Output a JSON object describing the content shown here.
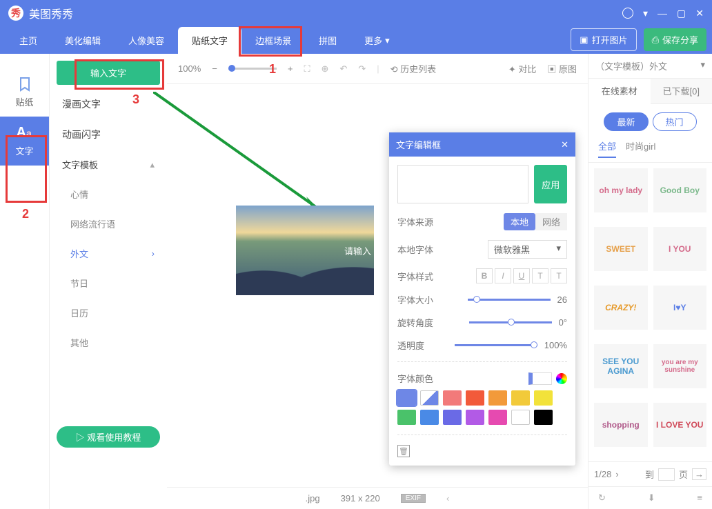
{
  "title": "美图秀秀",
  "menubar": {
    "home": "主页",
    "beautify": "美化编辑",
    "portrait": "人像美容",
    "sticker": "贴纸文字",
    "frame": "边框场景",
    "collage": "拼图",
    "more": "更多",
    "open": "打开图片",
    "save": "保存分享"
  },
  "rail": {
    "sticker": "贴纸",
    "text": "文字"
  },
  "panel": {
    "input": "输入文字",
    "comic": "漫画文字",
    "anim": "动画闪字",
    "template": "文字模板",
    "mood": "心情",
    "net": "网络流行语",
    "foreign": "外文",
    "festival": "节日",
    "calendar": "日历",
    "other": "其他",
    "guide": "观看使用教程"
  },
  "toolbar": {
    "zoom": "100%",
    "history": "历史列表",
    "compare": "对比",
    "original": "原图"
  },
  "canvas": {
    "placeholder": "请输入"
  },
  "status": {
    "name": ".jpg",
    "size": "391 x 220",
    "exif": "EXIF"
  },
  "annot": {
    "n1": "1",
    "n2": "2",
    "n3": "3"
  },
  "dlg": {
    "title": "文字编辑框",
    "apply": "应用",
    "source": "字体来源",
    "local": "本地",
    "web": "网络",
    "font_label": "本地字体",
    "font": "微软雅黑",
    "style": "字体样式",
    "b": "B",
    "i": "I",
    "u": "U",
    "t": "T",
    "tt": "T",
    "size_label": "字体大小",
    "size": "26",
    "rotate_label": "旋转角度",
    "rotate": "0°",
    "opacity_label": "透明度",
    "opacity": "100%",
    "color_label": "字体颜色"
  },
  "right": {
    "title": "（文字模板）外文",
    "tab_online": "在线素材",
    "tab_dl": "已下载[0]",
    "new": "最新",
    "hot": "热门",
    "cat_all": "全部",
    "cat_girl": "时尚girl",
    "thumbs": [
      "oh my lady",
      "Good Boy",
      "SWEET",
      "I YOU",
      "CRAZY!",
      "I♥Y",
      "SEE YOU AGINA",
      "you are my sunshine",
      "shopping",
      "I LOVE YOU"
    ],
    "page": "1/28",
    "page_label": "到",
    "page_unit": "页"
  }
}
